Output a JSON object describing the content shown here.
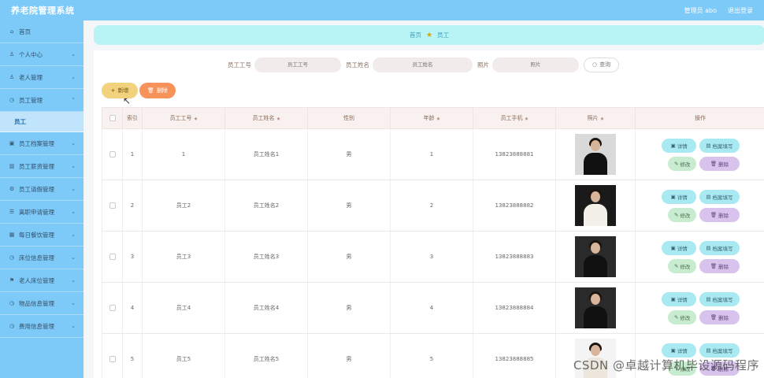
{
  "app": {
    "title": "养老院管理系统",
    "user_label": "管理员 abo",
    "logout_label": "退出登录"
  },
  "sidebar": {
    "items": [
      {
        "label": "首页",
        "icon": "home-icon"
      },
      {
        "label": "个人中心",
        "icon": "person-icon"
      },
      {
        "label": "老人管理",
        "icon": "person-icon"
      },
      {
        "label": "员工管理",
        "icon": "clock-icon"
      },
      {
        "label": "员工",
        "icon": ""
      },
      {
        "label": "员工档案管理",
        "icon": "folder-icon"
      },
      {
        "label": "员工薪资管理",
        "icon": "chart-icon"
      },
      {
        "label": "员工请假管理",
        "icon": "gear-icon"
      },
      {
        "label": "离职申请管理",
        "icon": "list-icon"
      },
      {
        "label": "每日餐饮管理",
        "icon": "grid-icon"
      },
      {
        "label": "床位信息管理",
        "icon": "clock-icon"
      },
      {
        "label": "老人床位管理",
        "icon": "flag-icon"
      },
      {
        "label": "物品信息管理",
        "icon": "clock-icon"
      },
      {
        "label": "费用信息管理",
        "icon": "clock-icon"
      }
    ]
  },
  "breadcrumb": {
    "home": "首页",
    "current": "员工"
  },
  "search": {
    "fields": [
      {
        "label": "员工工号",
        "placeholder": "员工工号"
      },
      {
        "label": "员工姓名",
        "placeholder": "员工姓名"
      },
      {
        "label": "照片",
        "placeholder": "照片"
      }
    ],
    "button": "查询"
  },
  "toolbar": {
    "add_label": "新增",
    "delete_label": "删除"
  },
  "table": {
    "headers": {
      "index": "索引",
      "emp_no": "员工工号",
      "name": "员工姓名",
      "gender": "性别",
      "age": "年龄",
      "phone": "员工手机",
      "photo": "照片",
      "ops": "操作"
    },
    "row_ops": {
      "detail": "详情",
      "fill": "档案填写",
      "edit": "修改",
      "delete": "删除"
    },
    "rows": [
      {
        "index": "1",
        "emp_no": "1",
        "name": "员工姓名1",
        "gender": "男",
        "age": "1",
        "phone": "13823888881"
      },
      {
        "index": "2",
        "emp_no": "员工2",
        "name": "员工姓名2",
        "gender": "男",
        "age": "2",
        "phone": "13823888882"
      },
      {
        "index": "3",
        "emp_no": "员工3",
        "name": "员工姓名3",
        "gender": "男",
        "age": "3",
        "phone": "13823888883"
      },
      {
        "index": "4",
        "emp_no": "员工4",
        "name": "员工姓名4",
        "gender": "男",
        "age": "4",
        "phone": "13823888884"
      },
      {
        "index": "5",
        "emp_no": "员工5",
        "name": "员工姓名5",
        "gender": "男",
        "age": "5",
        "phone": "13823888885"
      }
    ]
  },
  "watermark": "CSDN @卓越计算机毕设源码程序"
}
